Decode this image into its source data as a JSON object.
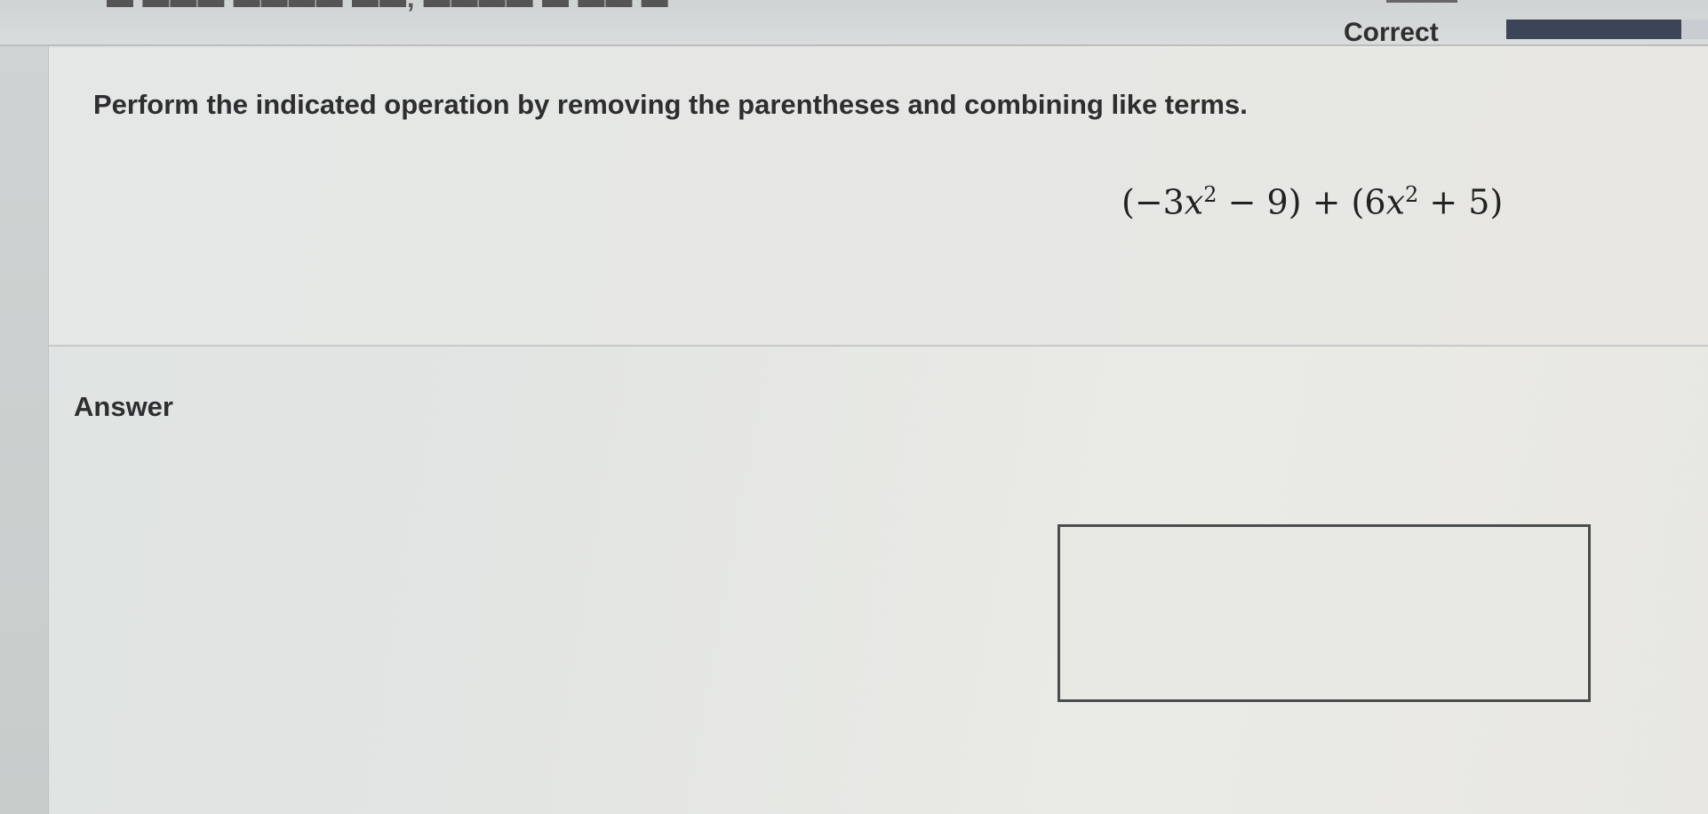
{
  "header": {
    "cut_text": "▬ ▬▬▬ ▬▬▬▬ ▬▬, ▬▬▬▬ ▬ ▬▬ ▬",
    "cut_text_right": "▬▬▬▬",
    "status": "Correct",
    "progress_fraction": 0.82,
    "colors": {
      "progress_fill": "#3c4458",
      "progress_track": "#c9cdd2"
    }
  },
  "question": {
    "instruction": "Perform the indicated operation by removing the parentheses and combining like terms.",
    "expression": {
      "open1": "(−3",
      "var1": "x",
      "exp1": "2",
      "mid": " − 9) + (6",
      "var2": "x",
      "exp2": "2",
      "close": " + 5)"
    }
  },
  "answer": {
    "label": "Answer",
    "input_value": "",
    "input_placeholder": ""
  }
}
